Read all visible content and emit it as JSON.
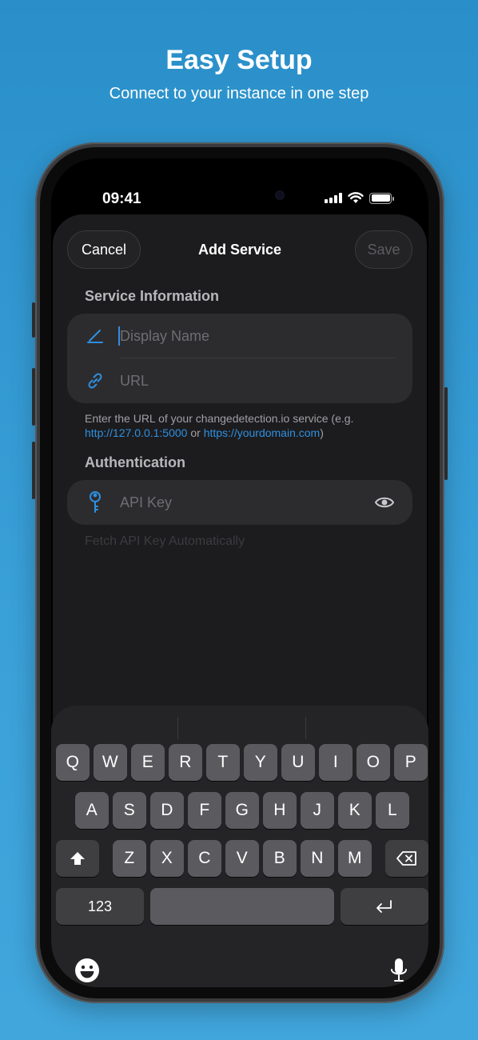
{
  "hero": {
    "title": "Easy Setup",
    "subtitle": "Connect to your instance in one step"
  },
  "status_bar": {
    "time": "09:41",
    "icons": [
      "cellular-signal-icon",
      "wifi-icon",
      "battery-icon"
    ]
  },
  "nav": {
    "cancel": "Cancel",
    "title": "Add Service",
    "save": "Save"
  },
  "service_info": {
    "header": "Service Information",
    "display_name_placeholder": "Display Name",
    "url_placeholder": "URL",
    "helper_prefix": "Enter the URL of your changedetection.io service (e.g.",
    "helper_link1": "http://127.0.0.1:5000",
    "helper_or": " or ",
    "helper_link2": "https://yourdomain.com",
    "helper_suffix": ")"
  },
  "authentication": {
    "header": "Authentication",
    "api_key_placeholder": "API Key",
    "fetch_label": "Fetch API Key Automatically"
  },
  "keyboard": {
    "row1": [
      "Q",
      "W",
      "E",
      "R",
      "T",
      "Y",
      "U",
      "I",
      "O",
      "P"
    ],
    "row2": [
      "A",
      "S",
      "D",
      "F",
      "G",
      "H",
      "J",
      "K",
      "L"
    ],
    "row3": [
      "Z",
      "X",
      "C",
      "V",
      "B",
      "N",
      "M"
    ],
    "numbers_key": "123"
  },
  "colors": {
    "accent": "#2f8fe0",
    "background": "#2a8fc9",
    "sheet": "#1c1c1e",
    "card": "#2c2c2e"
  }
}
